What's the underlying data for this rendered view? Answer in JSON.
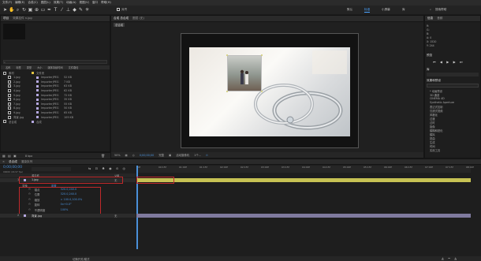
{
  "menu": [
    "文件(F)",
    "编辑(E)",
    "合成(C)",
    "图层(L)",
    "效果(T)",
    "动画(A)",
    "视图(V)",
    "窗口",
    "帮助(H)"
  ],
  "toolbar": {
    "icons": [
      "selection-tool-icon",
      "hand-tool-icon",
      "zoom-tool-icon",
      "rotate-tool-icon",
      "camera-tool-icon",
      "pan-behind-icon",
      "rectangle-tool-icon",
      "pen-tool-icon",
      "type-tool-icon",
      "brush-tool-icon",
      "clone-stamp-icon",
      "eraser-tool-icon",
      "roto-brush-icon",
      "puppet-tool-icon"
    ],
    "snap_label": "对齐",
    "workspaces": [
      "默认",
      "标准",
      "小屏幕",
      "库"
    ],
    "active_workspace": "标准",
    "search_label": "搜索帮助"
  },
  "project_panel": {
    "tabs": [
      "项目",
      "效果控件 n.jpg"
    ],
    "columns": [
      "名称",
      "标签",
      "类型",
      "大小",
      "媒体持续时间",
      "文件路径"
    ],
    "items": [
      {
        "name": "素材",
        "type": "文件夹",
        "size": "",
        "color": "#e0c341"
      },
      {
        "name": "1.jpg",
        "type": "ImporterJPEG",
        "size": "52 KB",
        "color": "#b5a8e0"
      },
      {
        "name": "2.jpg",
        "type": "ImporterJPEG",
        "size": "7 KB",
        "color": "#b5a8e0"
      },
      {
        "name": "3.jpg",
        "type": "ImporterJPEG",
        "size": "63 KB",
        "color": "#b5a8e0"
      },
      {
        "name": "4.jpg",
        "type": "ImporterJPEG",
        "size": "62 KB",
        "color": "#b5a8e0"
      },
      {
        "name": "5.jpg",
        "type": "ImporterJPEG",
        "size": "72 KB",
        "color": "#b5a8e0"
      },
      {
        "name": "6.jpg",
        "type": "ImporterJPEG",
        "size": "35 KB",
        "color": "#b5a8e0"
      },
      {
        "name": "7.jpg",
        "type": "ImporterJPEG",
        "size": "55 KB",
        "color": "#b5a8e0"
      },
      {
        "name": "8.jpg",
        "type": "ImporterJPEG",
        "size": "50 KB",
        "color": "#b5a8e0"
      },
      {
        "name": "9.jpg",
        "type": "ImporterJPEG",
        "size": "65 KB",
        "color": "#b5a8e0"
      },
      {
        "name": "背景.jpg",
        "type": "ImporterJPEG",
        "size": "109 KB",
        "color": "#b5a8e0"
      },
      {
        "name": "总合成",
        "type": "合成",
        "size": "",
        "color": "#b5a8e0"
      }
    ],
    "bottom_depth": "8 bpc"
  },
  "composition_panel": {
    "tabs": [
      "合成 总合成",
      "图层 (无)"
    ],
    "breadcrumb": "总合成",
    "footer": {
      "zoom": "50%",
      "timecode": "0;00;00;00",
      "resolution": "完整",
      "camera": "活动摄像机",
      "views": "1个..."
    }
  },
  "right_panel": {
    "tabs": [
      "信息",
      "音频"
    ],
    "info_lines": [
      "R:",
      "G:",
      "B:",
      "A: 0",
      "X: 1520",
      "Y: 244"
    ],
    "preview_title": "预览",
    "library_title": "库",
    "effects_title": "效果和预设",
    "effects_search": "",
    "effects": [
      "* 动画预设",
      "3D 通道",
      "CINEMA 4D",
      "Synthetic Aperture",
      "表达式控制",
      "沉浸式视频",
      "风格化",
      "过渡",
      "过时",
      "抠像",
      "模糊和锐化",
      "模拟",
      "扭曲",
      "生成",
      "时间",
      "实用工具"
    ]
  },
  "timeline": {
    "tabs": [
      "总合成",
      "渲染队列"
    ],
    "timecode": "0;00;00;00",
    "fps": "00000 (29.97 fps)",
    "header_cols": [
      "源名称",
      "父级"
    ],
    "ruler": [
      "0f",
      "00:15f",
      "01:00f",
      "01:15f",
      "02:00f",
      "02:15f",
      "03:00f",
      "03:15f",
      "04:00f",
      "04:15f",
      "05:00f",
      "05:15f",
      "06:00f",
      "06:15f",
      "07:00f",
      "07:15f",
      "08:00f"
    ],
    "layers": [
      {
        "num": "1",
        "name": "1.jpg",
        "parent": "无",
        "color": "#b5a8e0"
      },
      {
        "num": "2",
        "name": "背景.jpg",
        "parent": "无",
        "color": "#b5a8e0"
      }
    ],
    "transform_label": "变换",
    "transform_reset": "重置",
    "properties": [
      {
        "name": "锚点",
        "value": "320.0,240.0"
      },
      {
        "name": "位置",
        "value": "320.0,240.0"
      },
      {
        "name": "缩放",
        "value": "∞ 100.0,100.0%"
      },
      {
        "name": "旋转",
        "value": "0x+0.0°"
      },
      {
        "name": "不透明度",
        "value": "100%"
      }
    ],
    "footer_label": "切换开关/模式"
  }
}
